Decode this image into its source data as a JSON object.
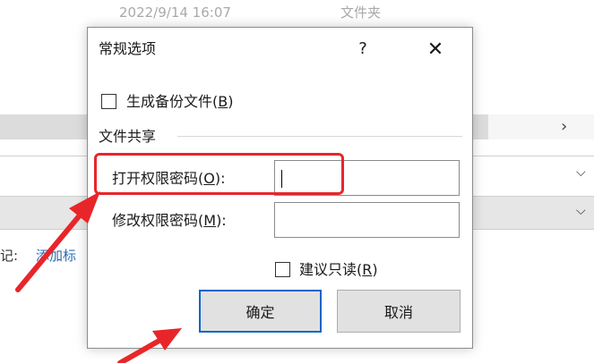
{
  "background": {
    "date_text": "2022/9/14 16:07",
    "type_text": "文件夹",
    "tag_label": "记:",
    "tag_link": "添加标"
  },
  "dialog": {
    "title": "常规选项",
    "help_glyph": "?",
    "close_glyph": "✕",
    "backup_checkbox": {
      "label_prefix": "生成备份文件(",
      "accel": "B",
      "label_suffix": ")",
      "checked": false
    },
    "section_title": "文件共享",
    "open_password": {
      "label_prefix": "打开权限密码(",
      "accel": "O",
      "label_suffix": "):",
      "value": ""
    },
    "modify_password": {
      "label_prefix": "修改权限密码(",
      "accel": "M",
      "label_suffix": "):",
      "value": ""
    },
    "readonly_checkbox": {
      "label_prefix": "建议只读(",
      "accel": "R",
      "label_suffix": ")",
      "checked": false
    },
    "ok_label": "确定",
    "cancel_label": "取消"
  },
  "colors": {
    "highlight": "#e8262a",
    "arrow": "#e8262a",
    "ok_focus_border": "#0a64c9",
    "link": "#2b6cb0"
  }
}
